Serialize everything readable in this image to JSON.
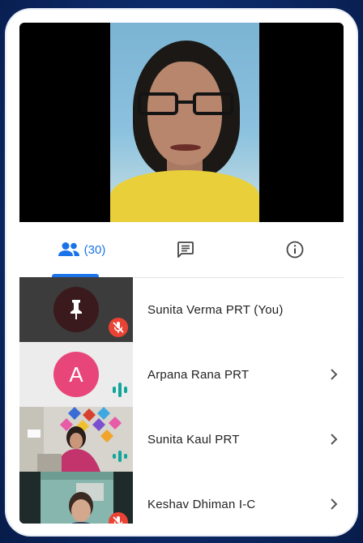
{
  "tabs": {
    "people_count": "(30)",
    "people_icon": "people-icon",
    "chat_icon": "chat-icon",
    "info_icon": "info-icon"
  },
  "participants": [
    {
      "name": "Sunita Verma PRT (You)",
      "status": "muted",
      "tile": "pin-avatar"
    },
    {
      "name": "Arpana Rana PRT",
      "avatar_letter": "A",
      "status": "speaking",
      "tile": "letter-avatar"
    },
    {
      "name": "Sunita Kaul PRT",
      "status": "speaking",
      "tile": "video"
    },
    {
      "name": "Keshav Dhiman I-C",
      "status": "muted",
      "tile": "video"
    }
  ],
  "colors": {
    "accent": "#1a73e8",
    "muted_badge": "#ea4335",
    "avatar_pink": "#e8467a",
    "audio_teal": "#12a69b",
    "frame_bg": "#0d2b6b"
  }
}
